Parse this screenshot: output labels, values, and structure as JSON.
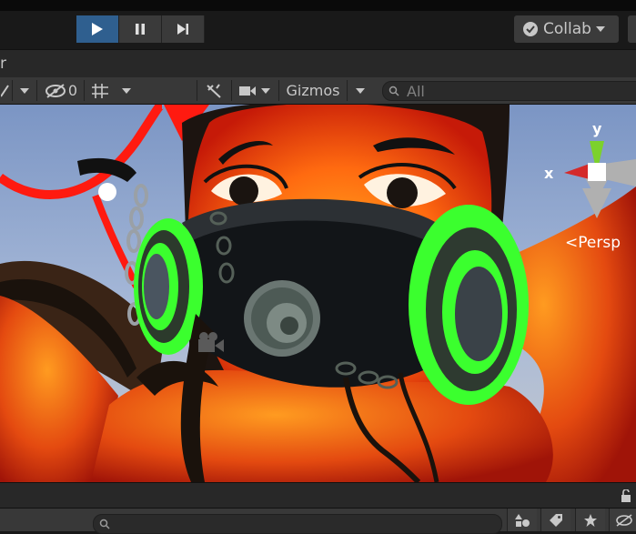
{
  "toolbar": {
    "collab_label": "Collab"
  },
  "scene_tab": {
    "label": "r"
  },
  "scene_toolbar": {
    "hidden_count": "0",
    "gizmos_label": "Gizmos",
    "search_placeholder": "All"
  },
  "viewport": {
    "axis_y": "y",
    "axis_x": "x",
    "projection_label": "Persp"
  },
  "icons": {
    "play": "play-icon",
    "pause": "pause-icon",
    "step": "step-icon",
    "collab_check": "check-icon",
    "visibility": "eye-slash-icon",
    "grid": "grid-icon",
    "effects": "effects-icon",
    "camera": "camera-icon",
    "search": "search-icon",
    "lock": "lock-icon",
    "label": "tag-icon",
    "favorite": "star-icon"
  },
  "colors": {
    "play_active": "#2f5f8f",
    "mask_green": "#3bff2e",
    "gizmo_y": "#7cd12c",
    "gizmo_x": "#d42a2a"
  }
}
